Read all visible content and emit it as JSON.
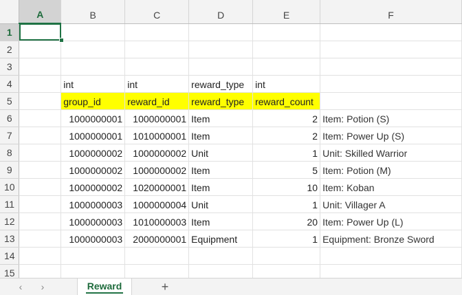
{
  "columns": [
    "A",
    "B",
    "C",
    "D",
    "E",
    "F"
  ],
  "rows": [
    {
      "n": "1",
      "cells": [
        "",
        "",
        "",
        "",
        "",
        ""
      ]
    },
    {
      "n": "2",
      "cells": [
        "",
        "",
        "",
        "",
        "",
        ""
      ]
    },
    {
      "n": "3",
      "cells": [
        "",
        "",
        "",
        "",
        "",
        ""
      ]
    },
    {
      "n": "4",
      "cells": [
        "",
        "int",
        "int",
        "reward_type",
        "int",
        ""
      ]
    },
    {
      "n": "5",
      "cells": [
        "",
        "group_id",
        "reward_id",
        "reward_type",
        "reward_count",
        ""
      ]
    },
    {
      "n": "6",
      "cells": [
        "",
        "1000000001",
        "1000000001",
        "Item",
        "2",
        "Item: Potion (S)"
      ]
    },
    {
      "n": "7",
      "cells": [
        "",
        "1000000001",
        "1010000001",
        "Item",
        "2",
        "Item: Power Up (S)"
      ]
    },
    {
      "n": "8",
      "cells": [
        "",
        "1000000002",
        "1000000002",
        "Unit",
        "1",
        "Unit: Skilled Warrior"
      ]
    },
    {
      "n": "9",
      "cells": [
        "",
        "1000000002",
        "1000000002",
        "Item",
        "5",
        "Item: Potion (M)"
      ]
    },
    {
      "n": "10",
      "cells": [
        "",
        "1000000002",
        "1020000001",
        "Item",
        "10",
        "Item: Koban"
      ]
    },
    {
      "n": "11",
      "cells": [
        "",
        "1000000003",
        "1000000004",
        "Unit",
        "1",
        "Unit: Villager A"
      ]
    },
    {
      "n": "12",
      "cells": [
        "",
        "1000000003",
        "1010000003",
        "Item",
        "20",
        "Item: Power Up (L)"
      ]
    },
    {
      "n": "13",
      "cells": [
        "",
        "1000000003",
        "2000000001",
        "Equipment",
        "1",
        "Equipment: Bronze Sword"
      ]
    },
    {
      "n": "14",
      "cells": [
        "",
        "",
        "",
        "",
        "",
        ""
      ]
    },
    {
      "n": "15",
      "cells": [
        "",
        "",
        "",
        "",
        "",
        ""
      ]
    }
  ],
  "header_highlight_color": "#ffff00",
  "active_cell": "A1",
  "sheet_tabs": [
    {
      "label": "Reward",
      "active": true
    }
  ],
  "tabbar": {
    "prev_icon": "‹",
    "next_icon": "›",
    "add_icon": "+"
  }
}
